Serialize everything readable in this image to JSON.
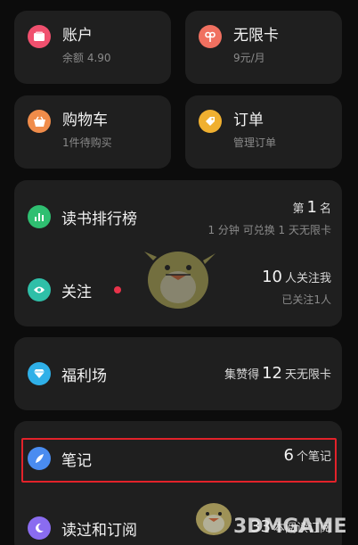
{
  "account": {
    "title": "账户",
    "subtitle": "余额 4.90",
    "color": "#f0506e"
  },
  "unlimited": {
    "title": "无限卡",
    "subtitle": "9元/月",
    "color": "#f07060"
  },
  "cart": {
    "title": "购物车",
    "subtitle": "1件待购买",
    "color": "#f08c4a"
  },
  "orders": {
    "title": "订单",
    "subtitle": "管理订单",
    "color": "#f0b030"
  },
  "ranking": {
    "label": "读书排行榜",
    "rank_prefix": "第",
    "rank_value": "1",
    "rank_suffix": "名",
    "sub": "1 分钟 可兑换 1 天无限卡",
    "color": "#2fbf71"
  },
  "follow": {
    "label": "关注",
    "count": "10",
    "count_suffix": "人关注我",
    "sub": "已关注1人",
    "color": "#2fbfa8"
  },
  "welfare": {
    "label": "福利场",
    "prefix": "集赞得",
    "value": "12",
    "suffix": "天无限卡",
    "color": "#2fb0e8"
  },
  "notes": {
    "label": "笔记",
    "value": "6",
    "suffix": "个笔记",
    "color": "#4a8cf0"
  },
  "read": {
    "label": "读过和订阅",
    "value": "33",
    "suffix": "本阅读订阅",
    "color": "#8a6cf0"
  },
  "watermark": {
    "brand": "3DMGAME",
    "small": "本阅读订阅"
  }
}
